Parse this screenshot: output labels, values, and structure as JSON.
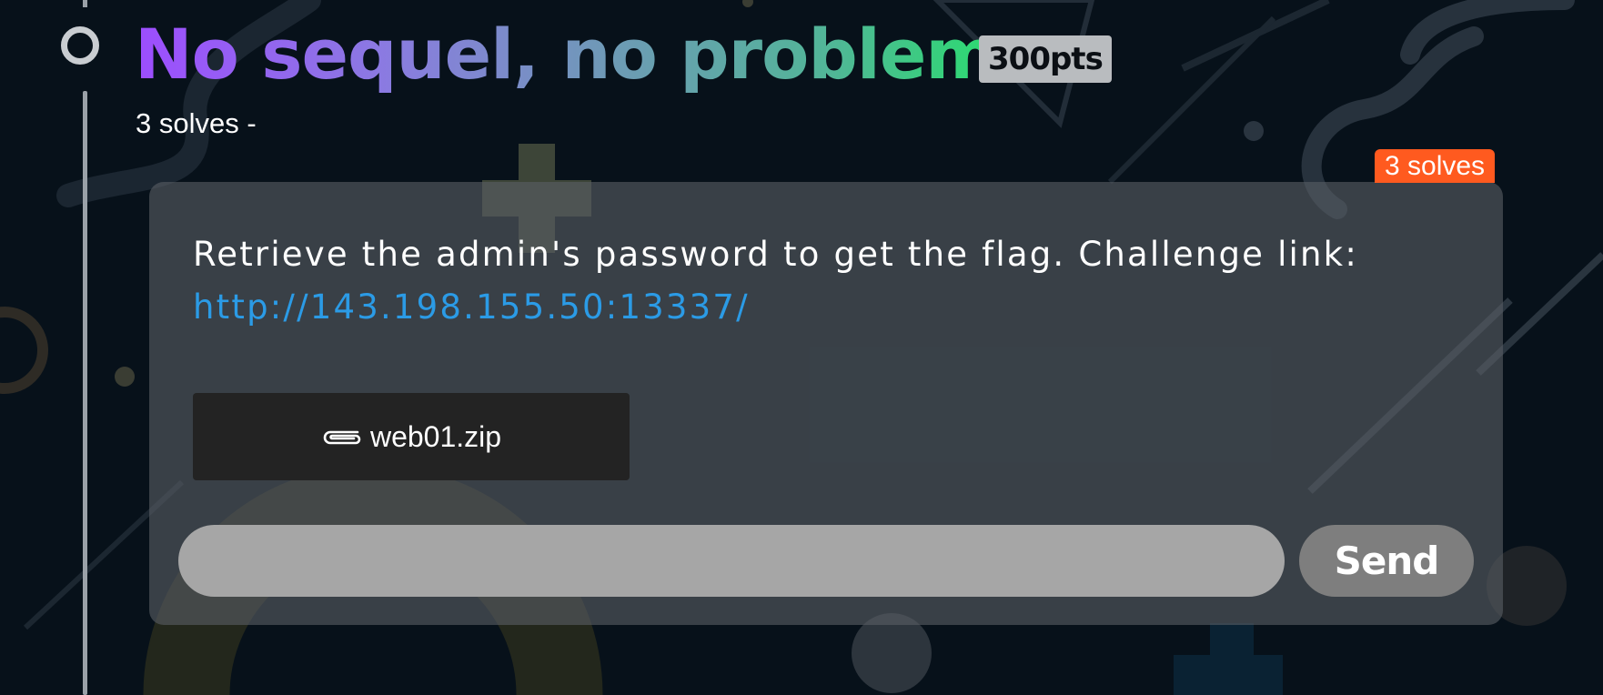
{
  "challenge": {
    "title": "No sequel, no problem",
    "points": "300pts",
    "solves_subtitle": "3 solves -",
    "solves_tag": "3 solves",
    "description": "Retrieve the admin's password to get the flag. Challenge link:",
    "link_text": "http://143.198.155.50:13337/",
    "attachment_name": "web01.zip",
    "attachment_icon": "paperclip-icon"
  },
  "flag_form": {
    "input_value": "",
    "placeholder": "",
    "send_label": "Send"
  },
  "colors": {
    "background": "#07111a",
    "title_gradient_start": "#9d4dff",
    "title_gradient_end": "#2bdc70",
    "solves_tag": "#ff5a1f",
    "link": "#2b9be6",
    "card": "#585e64",
    "input": "#a6a6a6",
    "send_button": "#7e7e7e"
  }
}
